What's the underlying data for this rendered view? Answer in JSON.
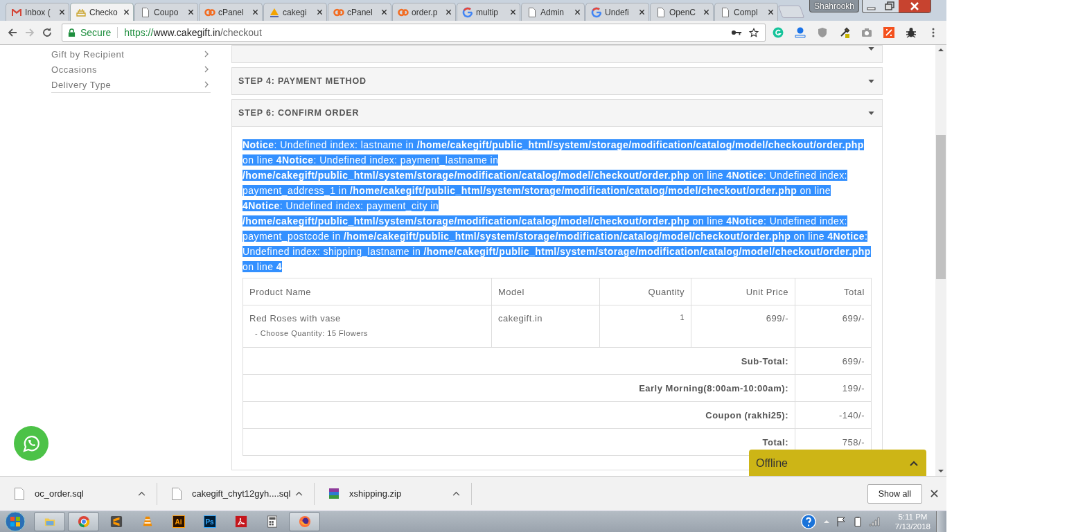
{
  "browser": {
    "tabs": [
      {
        "title": "Inbox (",
        "kind": "gmail",
        "selected": false
      },
      {
        "title": "Checko",
        "kind": "cake",
        "selected": true
      },
      {
        "title": "Coupo",
        "kind": "page",
        "selected": false
      },
      {
        "title": "cPanel",
        "kind": "cpanel",
        "selected": false
      },
      {
        "title": "cakegi",
        "kind": "pma",
        "selected": false
      },
      {
        "title": "cPanel",
        "kind": "cpanel",
        "selected": false
      },
      {
        "title": "order.p",
        "kind": "cpanel",
        "selected": false
      },
      {
        "title": "multip",
        "kind": "google",
        "selected": false
      },
      {
        "title": "Admin",
        "kind": "page",
        "selected": false
      },
      {
        "title": "Undefi",
        "kind": "google",
        "selected": false
      },
      {
        "title": "OpenC",
        "kind": "page",
        "selected": false
      },
      {
        "title": "Compl",
        "kind": "page",
        "selected": false
      }
    ],
    "profile": "Shahrookh",
    "security": "Secure",
    "url": {
      "scheme": "https://",
      "host": "www.cakegift.in",
      "path": "/checkout"
    }
  },
  "sidebar": {
    "items": [
      "Gift by Recipient",
      "Occasions",
      "Delivery Type"
    ]
  },
  "checkout": {
    "steps": [
      {
        "title": "STEP 4: PAYMENT METHOD"
      },
      {
        "title": "STEP 6: CONFIRM ORDER"
      }
    ],
    "notice": "**Notice**: Undefined index: lastname in **/home/cakegift/public_html/system/storage/modification/catalog/model/checkout/order.php** on line **4Notice**: Undefined index: payment_lastname in **/home/cakegift/public_html/system/storage/modification/catalog/model/checkout/order.php** on line **4Notice**: Undefined index: payment_address_1 in **/home/cakegift/public_html/system/storage/modification/catalog/model/checkout/order.php** on line **4Notice**: Undefined index: payment_city in **/home/cakegift/public_html/system/storage/modification/catalog/model/checkout/order.php** on line **4Notice**: Undefined index: payment_postcode in **/home/cakegift/public_html/system/storage/modification/catalog/model/checkout/order.php** on line **4Notice**: Undefined index: shipping_lastname in **/home/cakegift/public_html/system/storage/modification/catalog/model/checkout/order.php** on line **4**",
    "table": {
      "columns": [
        "Product Name",
        "Model",
        "Quantity",
        "Unit Price",
        "Total"
      ],
      "rows": [
        {
          "product": "Red Roses with vase",
          "option": "- Choose Quantity: 15 Flowers",
          "model": "cakegift.in",
          "quantity": "1",
          "unit_price": "699/-",
          "total": "699/-"
        }
      ],
      "totals": [
        {
          "label": "Sub-Total:",
          "value": "699/-"
        },
        {
          "label": "Early Morning(8:00am-10:00am):",
          "value": "199/-"
        },
        {
          "label": "Coupon (rakhi25):",
          "value": "-140/-"
        },
        {
          "label": "Total:",
          "value": "758/-"
        }
      ]
    }
  },
  "chat": {
    "status": "Offline"
  },
  "downloads": {
    "items": [
      {
        "name": "oc_order.sql",
        "kind": "file"
      },
      {
        "name": "cakegift_chyt12gyh....sql",
        "kind": "file"
      },
      {
        "name": "xshipping.zip",
        "kind": "archive"
      }
    ],
    "show_all": "Show all"
  },
  "taskbar": {
    "apps": [
      {
        "kind": "explorer",
        "open": true
      },
      {
        "kind": "chrome",
        "open": true
      },
      {
        "kind": "sublime",
        "open": false
      },
      {
        "kind": "vlc",
        "open": false
      },
      {
        "kind": "illustrator",
        "label": "Ai",
        "open": false
      },
      {
        "kind": "photoshop",
        "label": "Ps",
        "open": false
      },
      {
        "kind": "acrobat",
        "open": false
      },
      {
        "kind": "calculator",
        "open": false
      },
      {
        "kind": "firefox",
        "open": true
      }
    ],
    "time": "5:11 PM",
    "date": "7/13/2018"
  }
}
